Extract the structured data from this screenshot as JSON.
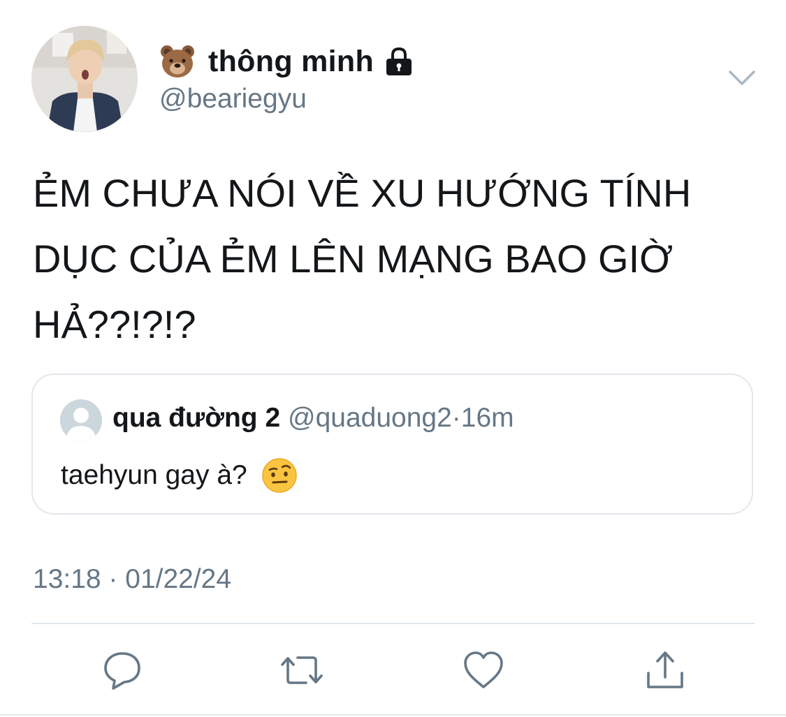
{
  "tweet": {
    "author": {
      "display_name": "thông minh",
      "handle": "@beariegyu",
      "name_emoji": "bear-face-emoji",
      "protected_icon": "lock-icon"
    },
    "text": "ẺM CHƯA NÓI VỀ XU HƯỚNG TÍNH DỤC CỦA ẺM LÊN MẠNG BAO GIỜ HẢ??!?!?",
    "quoted": {
      "display_name": "qua đường 2",
      "handle": "@quaduong2",
      "separator": "·",
      "time": "16m",
      "text": "taehyun gay à?",
      "emoji": "face-with-raised-eyebrow-emoji"
    },
    "timestamp": "13:18 · 01/22/24",
    "actions": [
      "reply-icon",
      "retweet-icon",
      "like-icon",
      "share-icon"
    ]
  },
  "colors": {
    "text": "#14171a",
    "secondary": "#657786",
    "border": "#e1e8ed"
  }
}
